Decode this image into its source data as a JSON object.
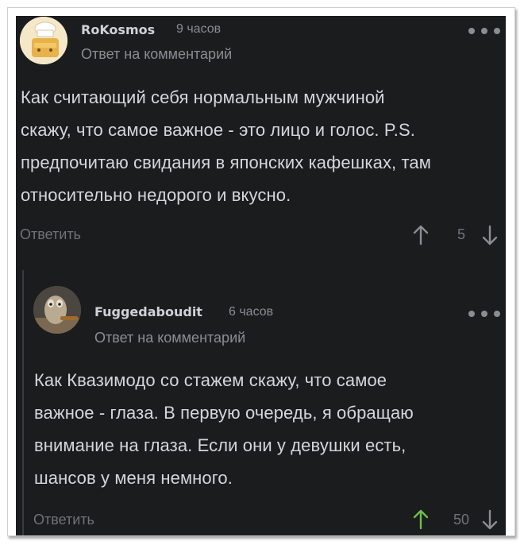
{
  "comments": [
    {
      "author": "RoKosmos",
      "time": "9 часов",
      "reply_label": "Ответ на комментарий",
      "text_lines": [
        "Как считающий себя нормальным мужчиной",
        "скажу, что самое важное - это лицо и голос.  P.S.",
        "предпочитаю свидания в японских кафешках, там",
        "относительно недорого и вкусно."
      ],
      "reply_button": "Ответить",
      "rating": "5",
      "upvoted": false,
      "icons": {
        "up": "arrow-up-icon",
        "down": "arrow-down-icon",
        "menu": "more-dots-icon"
      }
    },
    {
      "author": "Fuggedaboudit",
      "time": "6 часов",
      "reply_label": "Ответ на комментарий",
      "text_lines": [
        "Как Квазимодо со стажем скажу, что самое",
        "важное - глаза. В первую очередь, я обращаю",
        "внимание на глаза. Если они у девушки есть,",
        "шансов у меня немного."
      ],
      "reply_button": "Ответить",
      "rating": "50",
      "upvoted": true,
      "icons": {
        "up": "arrow-up-icon",
        "down": "arrow-down-icon",
        "menu": "more-dots-icon"
      }
    }
  ],
  "colors": {
    "background": "#1b1c1e",
    "text": "#d4d6d9",
    "muted": "#8a8d92",
    "upvote_active": "#6cc04a"
  }
}
